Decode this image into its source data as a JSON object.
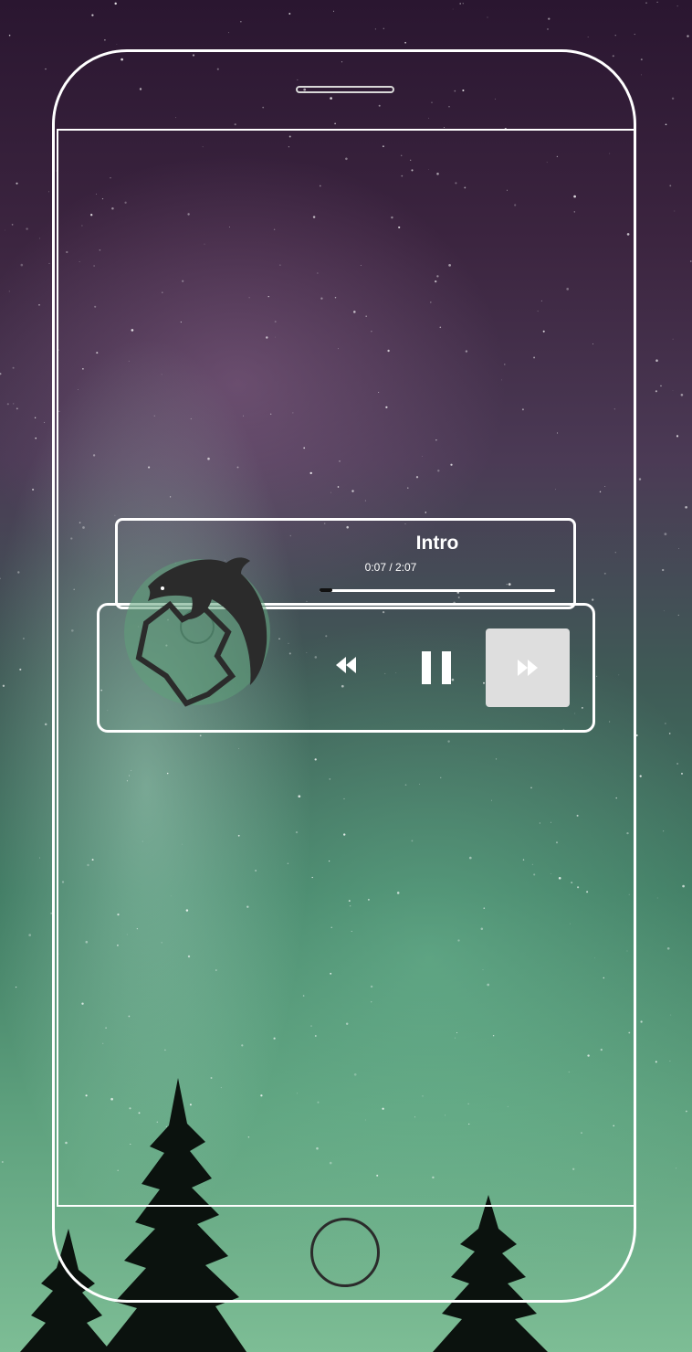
{
  "player": {
    "track_title": "Intro",
    "time_display": "0:07 / 2:07",
    "progress_fraction": 0.056,
    "controls": {
      "rewind_icon": "rewind-icon",
      "pause_icon": "pause-icon",
      "forward_icon": "fast-forward-icon"
    },
    "artwork_icon": "dolphin-logo"
  },
  "device": {
    "home_button_icon": "home-button"
  },
  "colors": {
    "panel_border": "#ffffff",
    "forward_button_bg": "#dedede",
    "progress_fill": "#111111"
  }
}
